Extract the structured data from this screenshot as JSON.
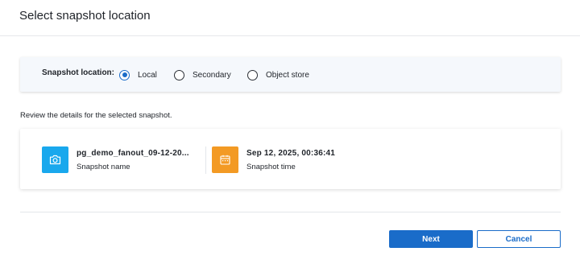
{
  "dialog": {
    "title": "Select snapshot location"
  },
  "location": {
    "label": "Snapshot location:",
    "options": [
      {
        "label": "Local",
        "selected": true
      },
      {
        "label": "Secondary",
        "selected": false
      },
      {
        "label": "Object store",
        "selected": false
      }
    ]
  },
  "review_text": "Review the details for the selected snapshot.",
  "details": {
    "name": {
      "value": "pg_demo_fanout_09-12-20...",
      "label": "Snapshot name",
      "icon": "camera-icon"
    },
    "time": {
      "value": "Sep 12, 2025, 00:36:41",
      "label": "Snapshot time",
      "icon": "calendar-icon"
    }
  },
  "buttons": {
    "next": "Next",
    "cancel": "Cancel"
  },
  "colors": {
    "accent": "#1a6cc9",
    "camera_bg": "#19a8ed",
    "calendar_bg": "#f39a24"
  }
}
